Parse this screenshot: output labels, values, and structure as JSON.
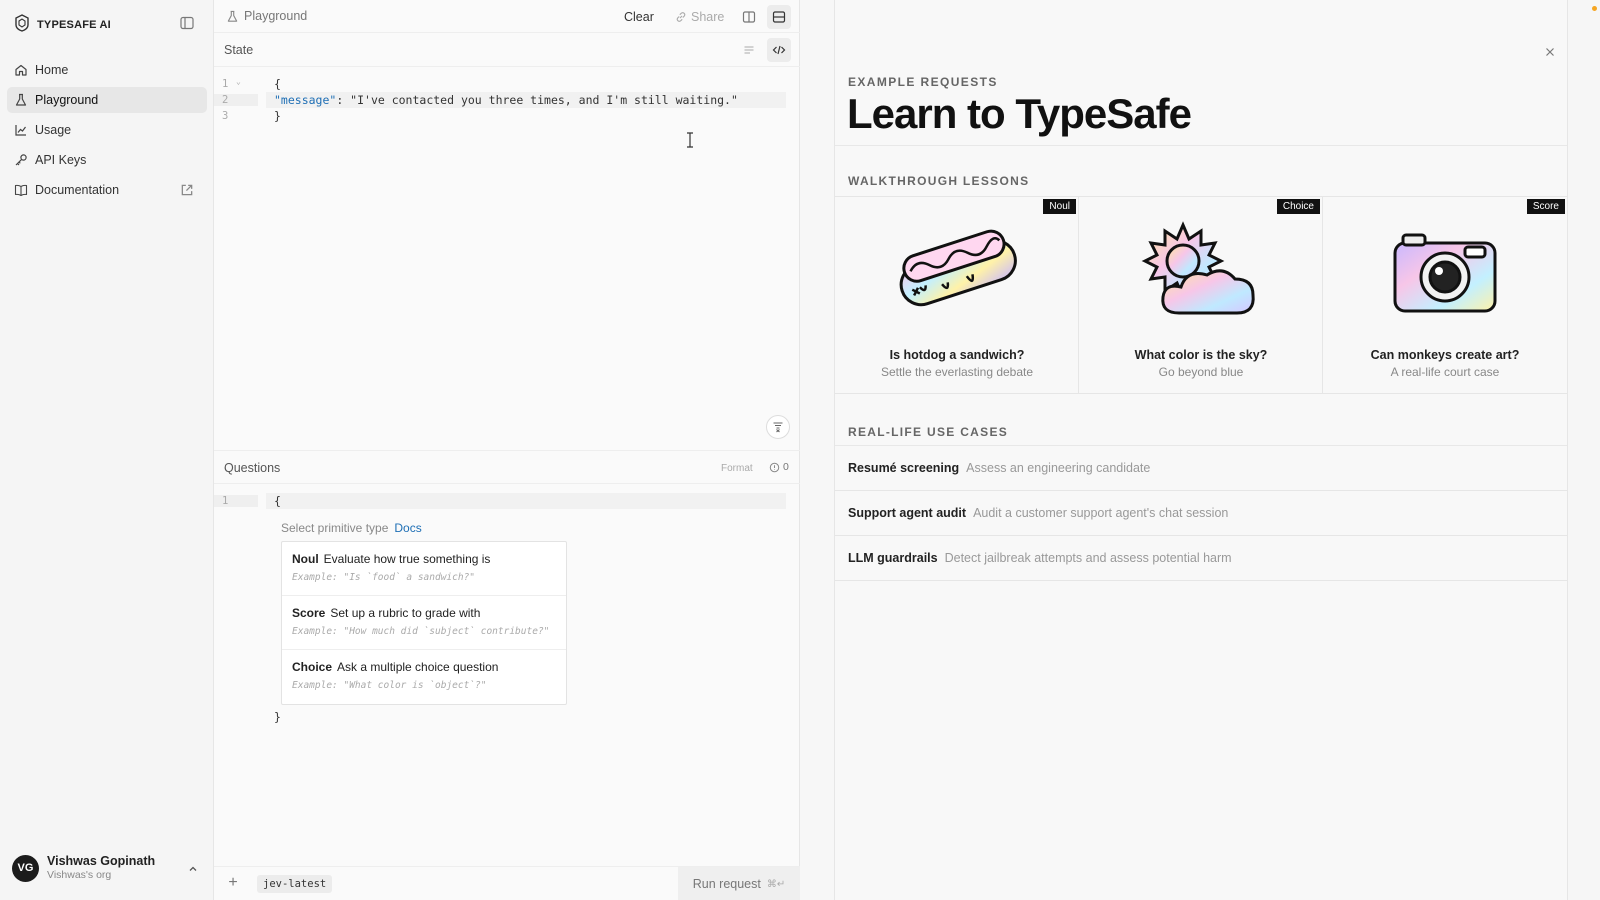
{
  "sidebar": {
    "brand": "TYPESAFE AI",
    "items": [
      {
        "label": "Home",
        "icon": "home-icon"
      },
      {
        "label": "Playground",
        "icon": "flask-icon"
      },
      {
        "label": "Usage",
        "icon": "chart-icon"
      },
      {
        "label": "API Keys",
        "icon": "key-icon"
      },
      {
        "label": "Documentation",
        "icon": "book-icon"
      }
    ],
    "user": {
      "initials": "VG",
      "name": "Vishwas Gopinath",
      "org": "Vishwas's org"
    }
  },
  "editor": {
    "title": "Playground",
    "clear_label": "Clear",
    "share_label": "Share",
    "state_title": "State",
    "state_lines": [
      {
        "n": "1",
        "text": "{"
      },
      {
        "n": "2",
        "key": "\"message\"",
        "sep": ": ",
        "value": "\"I've contacted you three times, and I'm still waiting.\""
      },
      {
        "n": "3",
        "text": "}"
      }
    ],
    "questions_title": "Questions",
    "format_label": "Format",
    "error_count": "0",
    "question_lines": [
      {
        "n": "1",
        "text": "{"
      },
      {
        "text": "}"
      }
    ],
    "primitive_label": "Select primitive type",
    "docs_label": "Docs",
    "primitives": [
      {
        "name": "Noul",
        "desc": "Evaluate how true something is",
        "example": "Example: \"Is `food` a sandwich?\""
      },
      {
        "name": "Score",
        "desc": "Set up a rubric to grade with",
        "example": "Example: \"How much did `subject` contribute?\""
      },
      {
        "name": "Choice",
        "desc": "Ask a multiple choice question",
        "example": "Example: \"What color is `object`?\""
      }
    ],
    "version_tag": "jev-latest",
    "run_label": "Run request",
    "run_shortcut": "⌘↵"
  },
  "examples": {
    "eyebrow": "EXAMPLE REQUESTS",
    "title": "Learn to TypeSafe",
    "lessons_heading": "WALKTHROUGH LESSONS",
    "lessons": [
      {
        "badge": "Noul",
        "title": "Is hotdog a sandwich?",
        "subtitle": "Settle the everlasting debate",
        "art": "hotdog-illustration"
      },
      {
        "badge": "Choice",
        "title": "What color is the sky?",
        "subtitle": "Go beyond blue",
        "art": "sun-cloud-illustration"
      },
      {
        "badge": "Score",
        "title": "Can monkeys create art?",
        "subtitle": "A real-life court case",
        "art": "camera-illustration"
      }
    ],
    "usecases_heading": "REAL-LIFE USE CASES",
    "usecases": [
      {
        "title": "Resumé screening",
        "desc": "Assess an engineering candidate"
      },
      {
        "title": "Support agent audit",
        "desc": "Audit a customer support agent's chat session"
      },
      {
        "title": "LLM guardrails",
        "desc": "Detect jailbreak attempts and assess potential harm"
      }
    ]
  },
  "colors": {
    "accent": "#1f6fb5",
    "badge": "#111111",
    "notification": "#f5a623"
  }
}
